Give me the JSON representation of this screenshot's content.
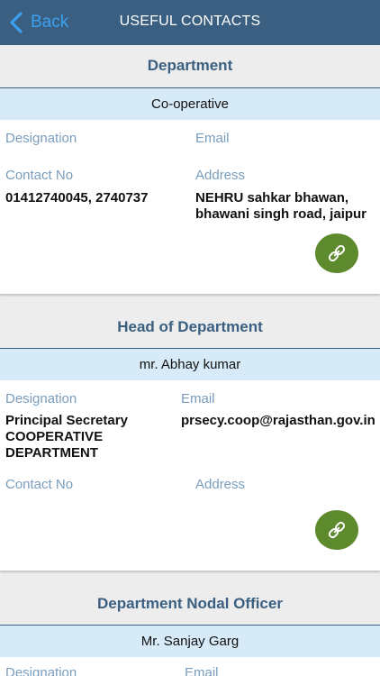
{
  "nav": {
    "back_label": "Back",
    "title": "USEFUL CONTACTS"
  },
  "labels": {
    "designation": "Designation",
    "email": "Email",
    "contact": "Contact No",
    "address": "Address"
  },
  "sections": [
    {
      "heading": "Department",
      "name": "Co-operative",
      "designation": "",
      "email": "",
      "contact": "01412740045, 2740737",
      "address": "NEHRU sahkar bhawan, bhawani singh road, jaipur"
    },
    {
      "heading": "Head of Department",
      "name": "mr. Abhay kumar",
      "designation": "Principal Secretary COOPERATIVE DEPARTMENT",
      "email": "prsecy.coop@rajasthan.gov.in",
      "contact": "",
      "address": ""
    },
    {
      "heading": "Department Nodal Officer",
      "name": "Mr. Sanjay Garg"
    }
  ],
  "icons": {
    "back": "chevron-left-icon",
    "link": "link-icon"
  },
  "colors": {
    "navbar": "#3a5f80",
    "back_text": "#3ba1f0",
    "name_bar": "#d6eaf8",
    "label": "#7a9dbd",
    "link_button": "#5e8a2e",
    "background": "#ededed"
  }
}
